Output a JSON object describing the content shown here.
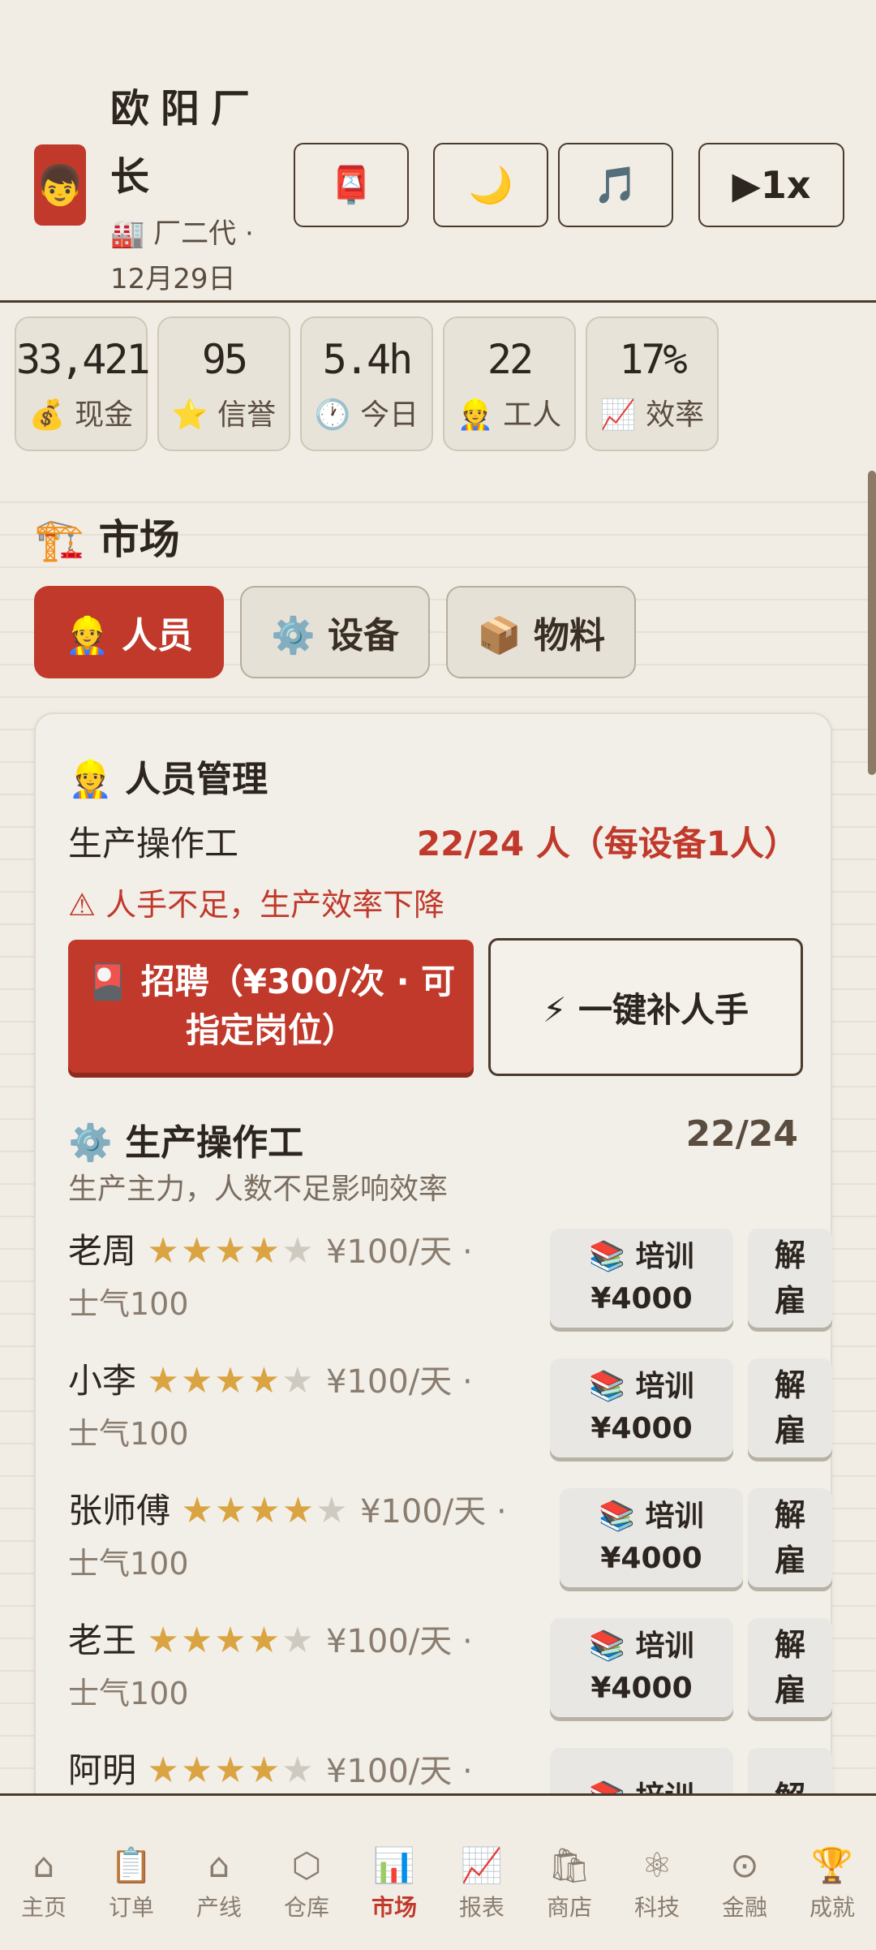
{
  "header": {
    "avatar": "👦",
    "name": "欧阳厂长",
    "subtitle": "🏭 厂二代 · 12月29日",
    "buttons": {
      "mail": "📮",
      "night": "🌙",
      "music": "🎵",
      "speed": "▶1x"
    }
  },
  "stats": [
    {
      "value": "33,421",
      "label": "💰 现金"
    },
    {
      "value": "95",
      "label": "⭐ 信誉"
    },
    {
      "value": "5.4h",
      "label": "🕐 今日"
    },
    {
      "value": "22",
      "label": "👷 工人"
    },
    {
      "value": "17%",
      "label": "📈 效率"
    }
  ],
  "market": {
    "title": "🏗️ 市场",
    "tabs": [
      {
        "label": "👷 人员"
      },
      {
        "label": "⚙️ 设备"
      },
      {
        "label": "📦 物料"
      }
    ]
  },
  "staff": {
    "title": "👷 人员管理",
    "role_label": "生产操作工",
    "role_count": "22/24 人（每设备1人）",
    "warning": "⚠ 人手不足，生产效率下降",
    "recruit_button": "🎴 招聘（¥300/次 · 可指定岗位）",
    "autofill_button": "⚡ 一键补人手",
    "group": {
      "title": "⚙️ 生产操作工",
      "count": "22/24",
      "desc": "生产主力，人数不足影响效率"
    },
    "workers": [
      {
        "name": "老周",
        "stars": "★★★★",
        "stars_off": "★",
        "wage": "¥100/天 ·",
        "morale": "士气100",
        "train": "📚 培训",
        "train_cost": "¥4000",
        "fire": "解雇"
      },
      {
        "name": "小李",
        "stars": "★★★★",
        "stars_off": "★",
        "wage": "¥100/天 ·",
        "morale": "士气100",
        "train": "📚 培训",
        "train_cost": "¥4000",
        "fire": "解雇"
      },
      {
        "name": "张师傅",
        "stars": "★★★★",
        "stars_off": "★",
        "wage": "¥100/天 ·",
        "morale": "士气100",
        "train": "📚 培训",
        "train_cost": "¥4000",
        "fire": "解雇"
      },
      {
        "name": "老王",
        "stars": "★★★★",
        "stars_off": "★",
        "wage": "¥100/天 ·",
        "morale": "士气100",
        "train": "📚 培训",
        "train_cost": "¥4000",
        "fire": "解雇"
      },
      {
        "name": "阿明",
        "stars": "★★★★",
        "stars_off": "★",
        "wage": "¥100/天 ·",
        "morale": "",
        "train": "📚 培训",
        "train_cost": "",
        "fire": "解"
      }
    ]
  },
  "nav": [
    {
      "icon": "⌂",
      "label": "主页"
    },
    {
      "icon": "📋",
      "label": "订单"
    },
    {
      "icon": "⌂",
      "label": "产线"
    },
    {
      "icon": "⬡",
      "label": "仓库"
    },
    {
      "icon": "📊",
      "label": "市场"
    },
    {
      "icon": "📈",
      "label": "报表"
    },
    {
      "icon": "🛍",
      "label": "商店"
    },
    {
      "icon": "⚛",
      "label": "科技"
    },
    {
      "icon": "⊙",
      "label": "金融"
    },
    {
      "icon": "🏆",
      "label": "成就"
    }
  ]
}
